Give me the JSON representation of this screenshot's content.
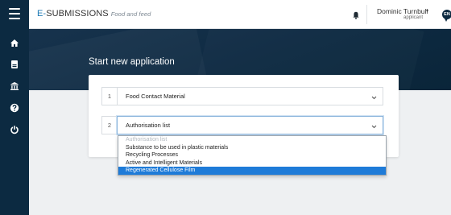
{
  "app": {
    "brand_prefix": "E-",
    "brand_name": "SUBMISSIONS",
    "brand_tagline": "Food and feed"
  },
  "user": {
    "name": "Dominic Turnbull",
    "role": "applicant",
    "language": "EN"
  },
  "sidebar": {
    "items": [
      {
        "icon": "menu-icon"
      },
      {
        "icon": "home-icon"
      },
      {
        "icon": "document-icon"
      },
      {
        "icon": "institution-icon"
      },
      {
        "icon": "help-icon"
      },
      {
        "icon": "power-icon"
      }
    ]
  },
  "page": {
    "title": "Start new application"
  },
  "form": {
    "rows": [
      {
        "number": "1",
        "value": "Food Contact Material"
      },
      {
        "number": "2",
        "value": "Authorisation list"
      }
    ],
    "dropdown": {
      "options": [
        {
          "label": "Authorisation list",
          "state": "placeholder"
        },
        {
          "label": "Substance to be used in plastic materials",
          "state": "normal"
        },
        {
          "label": "Recycling Processes",
          "state": "normal"
        },
        {
          "label": "Active and Intelligent Materials",
          "state": "normal"
        },
        {
          "label": "Regenerated Cellulose Film",
          "state": "highlighted"
        }
      ]
    }
  },
  "colors": {
    "sidebar": "#0c2a41",
    "brand_accent": "#1e7ab5",
    "highlight": "#1e7bd8"
  }
}
